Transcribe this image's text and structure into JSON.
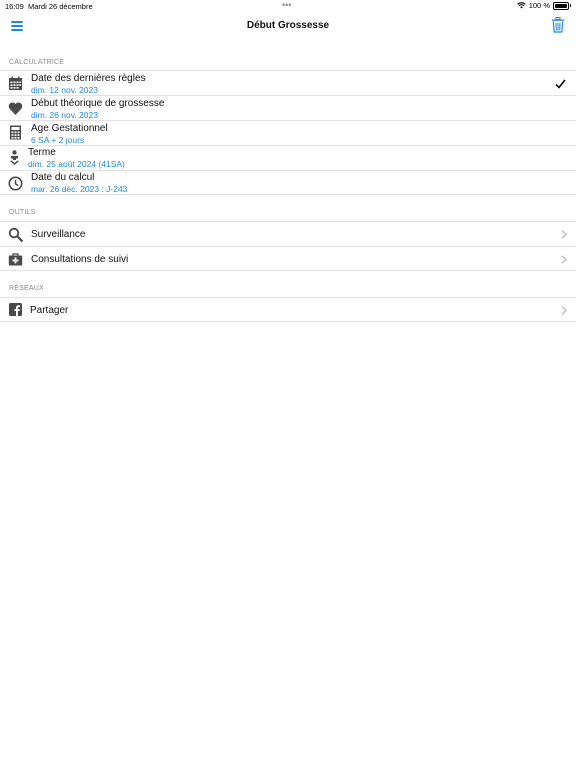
{
  "status": {
    "time": "16:09",
    "date": "Mardi 26 décembre",
    "dots": "•••",
    "battery": "100 %"
  },
  "nav": {
    "title": "Début Grossesse"
  },
  "sections": {
    "calc": "CALCULATRICE",
    "tools": "OUTILS",
    "networks": "RÉSEAUX"
  },
  "calc_rows": {
    "ddr_label": "Date des dernières règles",
    "ddr_value": "dim. 12 nov. 2023",
    "debut_label": "Début théorique de grossesse",
    "debut_value": "dim. 26 nov. 2023",
    "age_label": "Age Gestationnel",
    "age_value": "6  SA  + 2  jours",
    "terme_label": "Terme",
    "terme_value": "dim. 25 août 2024 (41SA)",
    "calcul_label": "Date du calcul",
    "calcul_value": "mar. 26 déc. 2023 : J-243"
  },
  "tools_rows": {
    "surveillance": "Surveillance",
    "consultations": "Consultations de suivi"
  },
  "network_rows": {
    "partager": "Partager"
  },
  "colors": {
    "accent": "#1e88e5",
    "icon": "#4a4a4a",
    "separator": "#e2e2e2",
    "section": "#8a8a8e"
  }
}
